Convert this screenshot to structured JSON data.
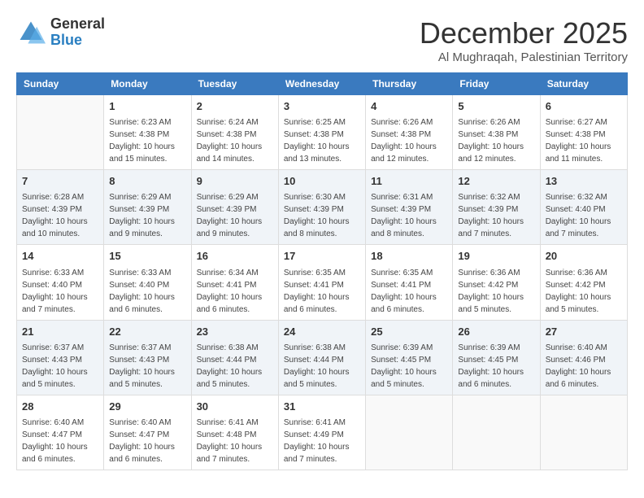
{
  "header": {
    "logo_line1": "General",
    "logo_line2": "Blue",
    "month": "December 2025",
    "location": "Al Mughraqah, Palestinian Territory"
  },
  "weekdays": [
    "Sunday",
    "Monday",
    "Tuesday",
    "Wednesday",
    "Thursday",
    "Friday",
    "Saturday"
  ],
  "weeks": [
    [
      {
        "day": "",
        "sunrise": "",
        "sunset": "",
        "daylight": ""
      },
      {
        "day": "1",
        "sunrise": "6:23 AM",
        "sunset": "4:38 PM",
        "daylight": "10 hours and 15 minutes."
      },
      {
        "day": "2",
        "sunrise": "6:24 AM",
        "sunset": "4:38 PM",
        "daylight": "10 hours and 14 minutes."
      },
      {
        "day": "3",
        "sunrise": "6:25 AM",
        "sunset": "4:38 PM",
        "daylight": "10 hours and 13 minutes."
      },
      {
        "day": "4",
        "sunrise": "6:26 AM",
        "sunset": "4:38 PM",
        "daylight": "10 hours and 12 minutes."
      },
      {
        "day": "5",
        "sunrise": "6:26 AM",
        "sunset": "4:38 PM",
        "daylight": "10 hours and 12 minutes."
      },
      {
        "day": "6",
        "sunrise": "6:27 AM",
        "sunset": "4:38 PM",
        "daylight": "10 hours and 11 minutes."
      }
    ],
    [
      {
        "day": "7",
        "sunrise": "6:28 AM",
        "sunset": "4:39 PM",
        "daylight": "10 hours and 10 minutes."
      },
      {
        "day": "8",
        "sunrise": "6:29 AM",
        "sunset": "4:39 PM",
        "daylight": "10 hours and 9 minutes."
      },
      {
        "day": "9",
        "sunrise": "6:29 AM",
        "sunset": "4:39 PM",
        "daylight": "10 hours and 9 minutes."
      },
      {
        "day": "10",
        "sunrise": "6:30 AM",
        "sunset": "4:39 PM",
        "daylight": "10 hours and 8 minutes."
      },
      {
        "day": "11",
        "sunrise": "6:31 AM",
        "sunset": "4:39 PM",
        "daylight": "10 hours and 8 minutes."
      },
      {
        "day": "12",
        "sunrise": "6:32 AM",
        "sunset": "4:39 PM",
        "daylight": "10 hours and 7 minutes."
      },
      {
        "day": "13",
        "sunrise": "6:32 AM",
        "sunset": "4:40 PM",
        "daylight": "10 hours and 7 minutes."
      }
    ],
    [
      {
        "day": "14",
        "sunrise": "6:33 AM",
        "sunset": "4:40 PM",
        "daylight": "10 hours and 7 minutes."
      },
      {
        "day": "15",
        "sunrise": "6:33 AM",
        "sunset": "4:40 PM",
        "daylight": "10 hours and 6 minutes."
      },
      {
        "day": "16",
        "sunrise": "6:34 AM",
        "sunset": "4:41 PM",
        "daylight": "10 hours and 6 minutes."
      },
      {
        "day": "17",
        "sunrise": "6:35 AM",
        "sunset": "4:41 PM",
        "daylight": "10 hours and 6 minutes."
      },
      {
        "day": "18",
        "sunrise": "6:35 AM",
        "sunset": "4:41 PM",
        "daylight": "10 hours and 6 minutes."
      },
      {
        "day": "19",
        "sunrise": "6:36 AM",
        "sunset": "4:42 PM",
        "daylight": "10 hours and 5 minutes."
      },
      {
        "day": "20",
        "sunrise": "6:36 AM",
        "sunset": "4:42 PM",
        "daylight": "10 hours and 5 minutes."
      }
    ],
    [
      {
        "day": "21",
        "sunrise": "6:37 AM",
        "sunset": "4:43 PM",
        "daylight": "10 hours and 5 minutes."
      },
      {
        "day": "22",
        "sunrise": "6:37 AM",
        "sunset": "4:43 PM",
        "daylight": "10 hours and 5 minutes."
      },
      {
        "day": "23",
        "sunrise": "6:38 AM",
        "sunset": "4:44 PM",
        "daylight": "10 hours and 5 minutes."
      },
      {
        "day": "24",
        "sunrise": "6:38 AM",
        "sunset": "4:44 PM",
        "daylight": "10 hours and 5 minutes."
      },
      {
        "day": "25",
        "sunrise": "6:39 AM",
        "sunset": "4:45 PM",
        "daylight": "10 hours and 5 minutes."
      },
      {
        "day": "26",
        "sunrise": "6:39 AM",
        "sunset": "4:45 PM",
        "daylight": "10 hours and 6 minutes."
      },
      {
        "day": "27",
        "sunrise": "6:40 AM",
        "sunset": "4:46 PM",
        "daylight": "10 hours and 6 minutes."
      }
    ],
    [
      {
        "day": "28",
        "sunrise": "6:40 AM",
        "sunset": "4:47 PM",
        "daylight": "10 hours and 6 minutes."
      },
      {
        "day": "29",
        "sunrise": "6:40 AM",
        "sunset": "4:47 PM",
        "daylight": "10 hours and 6 minutes."
      },
      {
        "day": "30",
        "sunrise": "6:41 AM",
        "sunset": "4:48 PM",
        "daylight": "10 hours and 7 minutes."
      },
      {
        "day": "31",
        "sunrise": "6:41 AM",
        "sunset": "4:49 PM",
        "daylight": "10 hours and 7 minutes."
      },
      {
        "day": "",
        "sunrise": "",
        "sunset": "",
        "daylight": ""
      },
      {
        "day": "",
        "sunrise": "",
        "sunset": "",
        "daylight": ""
      },
      {
        "day": "",
        "sunrise": "",
        "sunset": "",
        "daylight": ""
      }
    ]
  ],
  "labels": {
    "sunrise": "Sunrise:",
    "sunset": "Sunset:",
    "daylight": "Daylight:"
  }
}
